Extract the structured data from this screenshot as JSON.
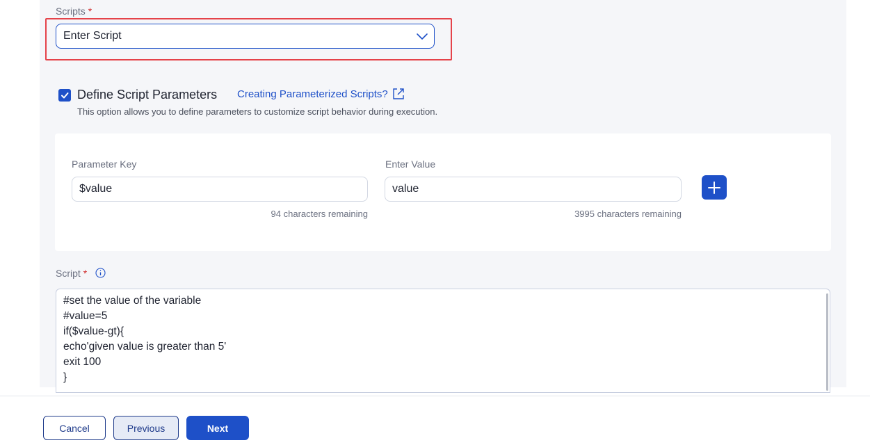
{
  "scripts_field": {
    "label": "Scripts",
    "required_mark": "*",
    "selected_value": "Enter Script",
    "chevron_icon": "chevron-down-icon"
  },
  "define_params": {
    "checked": true,
    "title": "Define Script Parameters",
    "help_link": "Creating Parameterized Scripts?",
    "help_link_icon": "external-link-icon",
    "description": "This option allows you to define parameters to customize script behavior during execution."
  },
  "parameters": {
    "key_label": "Parameter Key",
    "key_value": "$value",
    "key_counter": "94 characters remaining",
    "value_label": "Enter Value",
    "value_value": "value",
    "value_counter": "3995 characters remaining",
    "add_icon": "plus-icon"
  },
  "script_field": {
    "label": "Script",
    "required_mark": "*",
    "info_icon": "info-icon",
    "lines": [
      "#set the value of the variable",
      "#value=5",
      "if($value-gt){",
      "echo'given value is greater than 5'",
      "exit 100",
      "}"
    ]
  },
  "footer": {
    "cancel_label": "Cancel",
    "previous_label": "Previous",
    "next_label": "Next"
  },
  "colors": {
    "primary": "#1e50c8",
    "highlight_border": "#e5434a",
    "required": "#d02b2b",
    "panel_bg": "#f5f6f9"
  }
}
